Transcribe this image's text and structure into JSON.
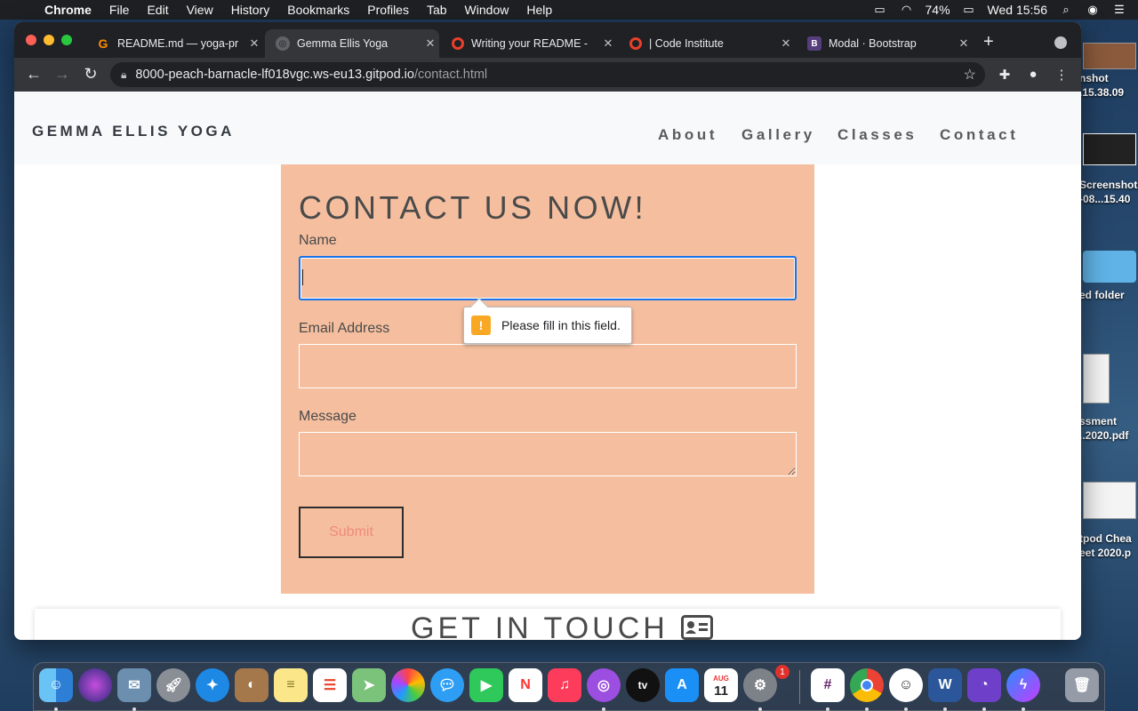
{
  "menubar": {
    "app": "Chrome",
    "items": [
      "File",
      "Edit",
      "View",
      "History",
      "Bookmarks",
      "Profiles",
      "Tab",
      "Window",
      "Help"
    ],
    "battery": "74%",
    "clock": "Wed 15:56"
  },
  "desktop": {
    "items": [
      {
        "line1": "nshot",
        "line2": ".15.38.09"
      },
      {
        "line1": "Screenshot",
        "line2": "-08...15.40"
      },
      {
        "line1": "ed folder",
        "line2": ""
      },
      {
        "line1": "ssment",
        "line2": "..2020.pdf"
      },
      {
        "line1": "tpod Chea",
        "line2": "eet 2020.p"
      }
    ]
  },
  "browser": {
    "tabs": [
      {
        "title": "README.md — yoga-pr",
        "icon": "gitpod-icon",
        "color": "#ff8a00"
      },
      {
        "title": "Gemma Ellis Yoga",
        "icon": "globe-icon",
        "color": "#5f6368"
      },
      {
        "title": "Writing your README -",
        "icon": "code-institute-icon",
        "color": "#e8402a"
      },
      {
        "title": "| Code Institute",
        "icon": "code-institute-icon",
        "color": "#e8402a"
      },
      {
        "title": "Modal · Bootstrap",
        "icon": "bootstrap-icon",
        "color": "#563d7c"
      }
    ],
    "active_tab": 1,
    "url_host": "8000-peach-barnacle-lf018vgc.ws-eu13.gitpod.io",
    "url_path": "/contact.html"
  },
  "page": {
    "brand": "GEMMA ELLIS YOGA",
    "nav": [
      "About",
      "Gallery",
      "Classes",
      "Contact"
    ],
    "form": {
      "heading": "CONTACT US NOW!",
      "name_label": "Name",
      "name_value": "",
      "email_label": "Email Address",
      "email_value": "",
      "message_label": "Message",
      "message_value": "",
      "submit_label": "Submit",
      "validation_message": "Please fill in this field."
    },
    "section2_title": "GET IN TOUCH"
  },
  "dock": {
    "apps": [
      "Finder",
      "Siri",
      "Mail",
      "Launchpad",
      "Safari",
      "Contacts",
      "Notes",
      "Reminders",
      "Maps",
      "Photos",
      "Messages",
      "FaceTime",
      "News",
      "Music",
      "Podcasts",
      "TV",
      "App Store",
      "Calendar",
      "System Preferences",
      "Slack",
      "Chrome",
      "Smile",
      "Word",
      "GitHub Desktop",
      "Messenger",
      "Trash"
    ],
    "calendar_month": "AUG",
    "calendar_day": "11",
    "prefs_badge": "1"
  }
}
